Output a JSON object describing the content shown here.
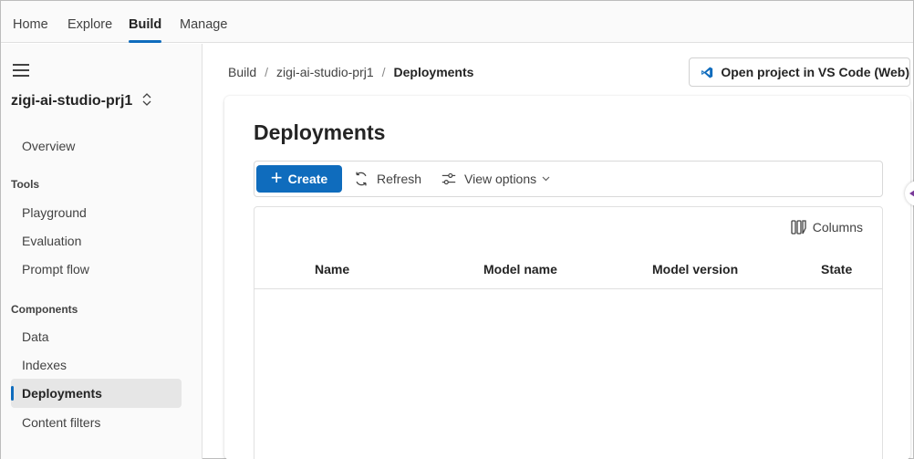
{
  "topnav": {
    "tabs": [
      {
        "label": "Home"
      },
      {
        "label": "Explore"
      },
      {
        "label": "Build"
      },
      {
        "label": "Manage"
      }
    ],
    "active": "Build"
  },
  "sidebar": {
    "menu_icon": "hamburger-icon",
    "project_name": "zigi-ai-studio-prj1",
    "project_chevron": "⌃⌄",
    "overview": "Overview",
    "tools_heading": "Tools",
    "tools": [
      "Playground",
      "Evaluation",
      "Prompt flow"
    ],
    "components_heading": "Components",
    "components": [
      "Data",
      "Indexes",
      "Deployments",
      "Content filters"
    ],
    "active_item": "Deployments"
  },
  "breadcrumb": {
    "items": [
      "Build",
      "zigi-ai-studio-prj1",
      "Deployments"
    ],
    "separator": "/"
  },
  "vscode_button": {
    "label": "Open project in VS Code (Web)",
    "icon": "vscode-icon"
  },
  "main": {
    "title": "Deployments",
    "toolbar": {
      "create_label": "Create",
      "refresh_label": "Refresh",
      "view_options_label": "View options"
    },
    "table": {
      "columns_label": "Columns",
      "headers": [
        "Name",
        "Model name",
        "Model version",
        "State"
      ],
      "rows": []
    }
  },
  "colors": {
    "accent": "#0f6cbd",
    "handle_arrow": "#7a3a9a"
  }
}
